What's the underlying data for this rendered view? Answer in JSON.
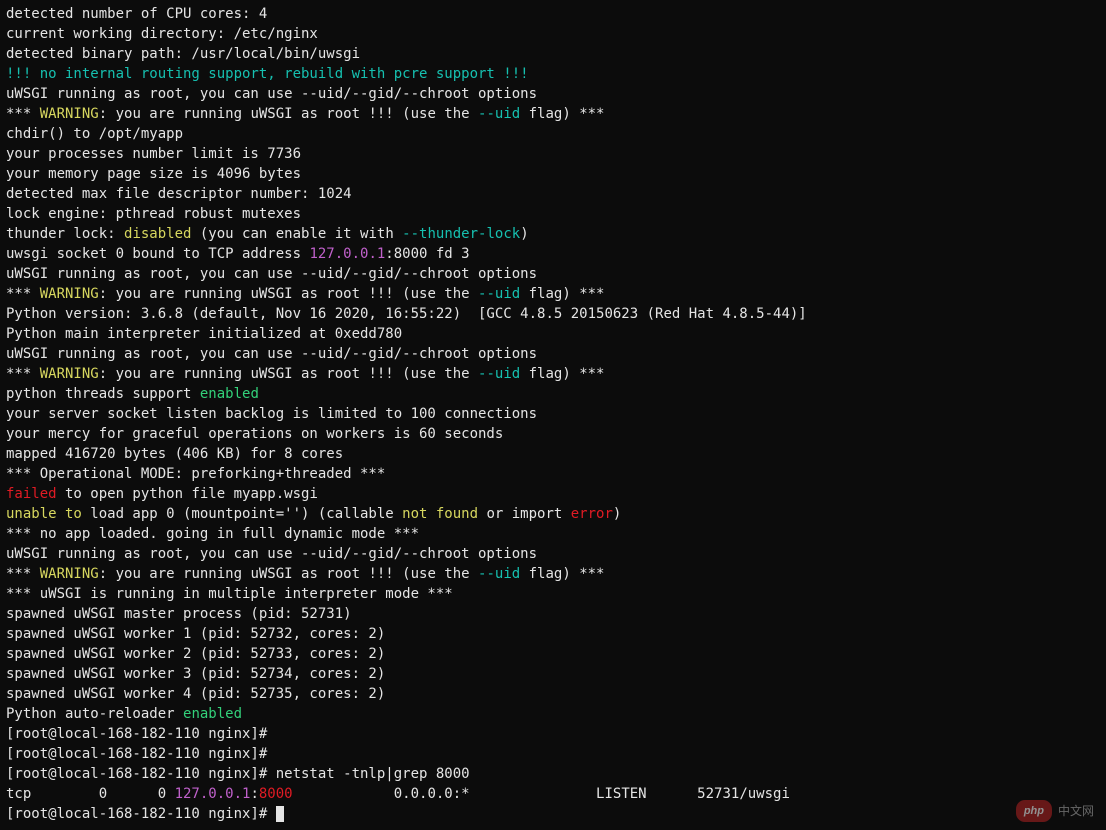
{
  "lines": [
    [
      {
        "t": "detected number of CPU cores: 4"
      }
    ],
    [
      {
        "t": "current working directory: /etc/nginx"
      }
    ],
    [
      {
        "t": "detected binary path: /usr/local/bin/uwsgi"
      }
    ],
    [
      {
        "t": "!!! no internal routing support, rebuild with pcre support !!!",
        "c": "c-teal"
      }
    ],
    [
      {
        "t": "uWSGI running as root, you can use --uid/--gid/--chroot options"
      }
    ],
    [
      {
        "t": "*** "
      },
      {
        "t": "WARNING",
        "c": "c-yellow"
      },
      {
        "t": ": you are running uWSGI as root !!! (use the "
      },
      {
        "t": "--uid",
        "c": "c-teal"
      },
      {
        "t": " flag) ***"
      }
    ],
    [
      {
        "t": "chdir() to /opt/myapp"
      }
    ],
    [
      {
        "t": "your processes number limit is 7736"
      }
    ],
    [
      {
        "t": "your memory page size is 4096 bytes"
      }
    ],
    [
      {
        "t": "detected max file descriptor number: 1024"
      }
    ],
    [
      {
        "t": "lock engine: pthread robust mutexes"
      }
    ],
    [
      {
        "t": "thunder lock: "
      },
      {
        "t": "disabled",
        "c": "c-yellow"
      },
      {
        "t": " (you can enable it with "
      },
      {
        "t": "--thunder-lock",
        "c": "c-teal"
      },
      {
        "t": ")"
      }
    ],
    [
      {
        "t": "uwsgi socket 0 bound to TCP address "
      },
      {
        "t": "127.0.0.1",
        "c": "c-magenta"
      },
      {
        "t": ":8000 fd 3"
      }
    ],
    [
      {
        "t": "uWSGI running as root, you can use --uid/--gid/--chroot options"
      }
    ],
    [
      {
        "t": "*** "
      },
      {
        "t": "WARNING",
        "c": "c-yellow"
      },
      {
        "t": ": you are running uWSGI as root !!! (use the "
      },
      {
        "t": "--uid",
        "c": "c-teal"
      },
      {
        "t": " flag) ***"
      }
    ],
    [
      {
        "t": "Python version: 3.6.8 (default, Nov 16 2020, 16:55:22)  [GCC 4.8.5 20150623 (Red Hat 4.8.5-44)]"
      }
    ],
    [
      {
        "t": "Python main interpreter initialized at 0xedd780"
      }
    ],
    [
      {
        "t": "uWSGI running as root, you can use --uid/--gid/--chroot options"
      }
    ],
    [
      {
        "t": "*** "
      },
      {
        "t": "WARNING",
        "c": "c-yellow"
      },
      {
        "t": ": you are running uWSGI as root !!! (use the "
      },
      {
        "t": "--uid",
        "c": "c-teal"
      },
      {
        "t": " flag) ***"
      }
    ],
    [
      {
        "t": "python threads support "
      },
      {
        "t": "enabled",
        "c": "c-green"
      }
    ],
    [
      {
        "t": "your server socket listen backlog is limited to 100 connections"
      }
    ],
    [
      {
        "t": "your mercy for graceful operations on workers is 60 seconds"
      }
    ],
    [
      {
        "t": "mapped 416720 bytes (406 KB) for 8 cores"
      }
    ],
    [
      {
        "t": "*** Operational MODE: preforking+threaded ***"
      }
    ],
    [
      {
        "t": "failed",
        "c": "c-red"
      },
      {
        "t": " to open python file myapp.wsgi"
      }
    ],
    [
      {
        "t": "unable to",
        "c": "c-yellow"
      },
      {
        "t": " load app 0 (mountpoint='') (callable "
      },
      {
        "t": "not found",
        "c": "c-yellow"
      },
      {
        "t": " or import "
      },
      {
        "t": "error",
        "c": "c-red"
      },
      {
        "t": ")"
      }
    ],
    [
      {
        "t": "*** no app loaded. going in full dynamic mode ***"
      }
    ],
    [
      {
        "t": "uWSGI running as root, you can use --uid/--gid/--chroot options"
      }
    ],
    [
      {
        "t": "*** "
      },
      {
        "t": "WARNING",
        "c": "c-yellow"
      },
      {
        "t": ": you are running uWSGI as root !!! (use the "
      },
      {
        "t": "--uid",
        "c": "c-teal"
      },
      {
        "t": " flag) ***"
      }
    ],
    [
      {
        "t": "*** uWSGI is running in multiple interpreter mode ***"
      }
    ],
    [
      {
        "t": "spawned uWSGI master process (pid: 52731)"
      }
    ],
    [
      {
        "t": "spawned uWSGI worker 1 (pid: 52732, cores: 2)"
      }
    ],
    [
      {
        "t": "spawned uWSGI worker 2 (pid: 52733, cores: 2)"
      }
    ],
    [
      {
        "t": "spawned uWSGI worker 3 (pid: 52734, cores: 2)"
      }
    ],
    [
      {
        "t": "spawned uWSGI worker 4 (pid: 52735, cores: 2)"
      }
    ],
    [
      {
        "t": "Python auto-reloader "
      },
      {
        "t": "enabled",
        "c": "c-green"
      }
    ],
    [
      {
        "t": "[root@local-168-182-110 nginx]# "
      }
    ],
    [
      {
        "t": "[root@local-168-182-110 nginx]# "
      }
    ],
    [
      {
        "t": "[root@local-168-182-110 nginx]# netstat -tnlp|grep 8000"
      }
    ],
    [
      {
        "t": "tcp        0      0 "
      },
      {
        "t": "127.0.0.1",
        "c": "c-magenta"
      },
      {
        "t": ":"
      },
      {
        "t": "8000",
        "c": "c-red"
      },
      {
        "t": "            0.0.0.0:*               LISTEN      52731/uwsgi         "
      }
    ],
    [
      {
        "t": "[root@local-168-182-110 nginx]# "
      }
    ]
  ],
  "prompt_active": true,
  "watermark": {
    "pill": "php",
    "text": "中文网"
  }
}
